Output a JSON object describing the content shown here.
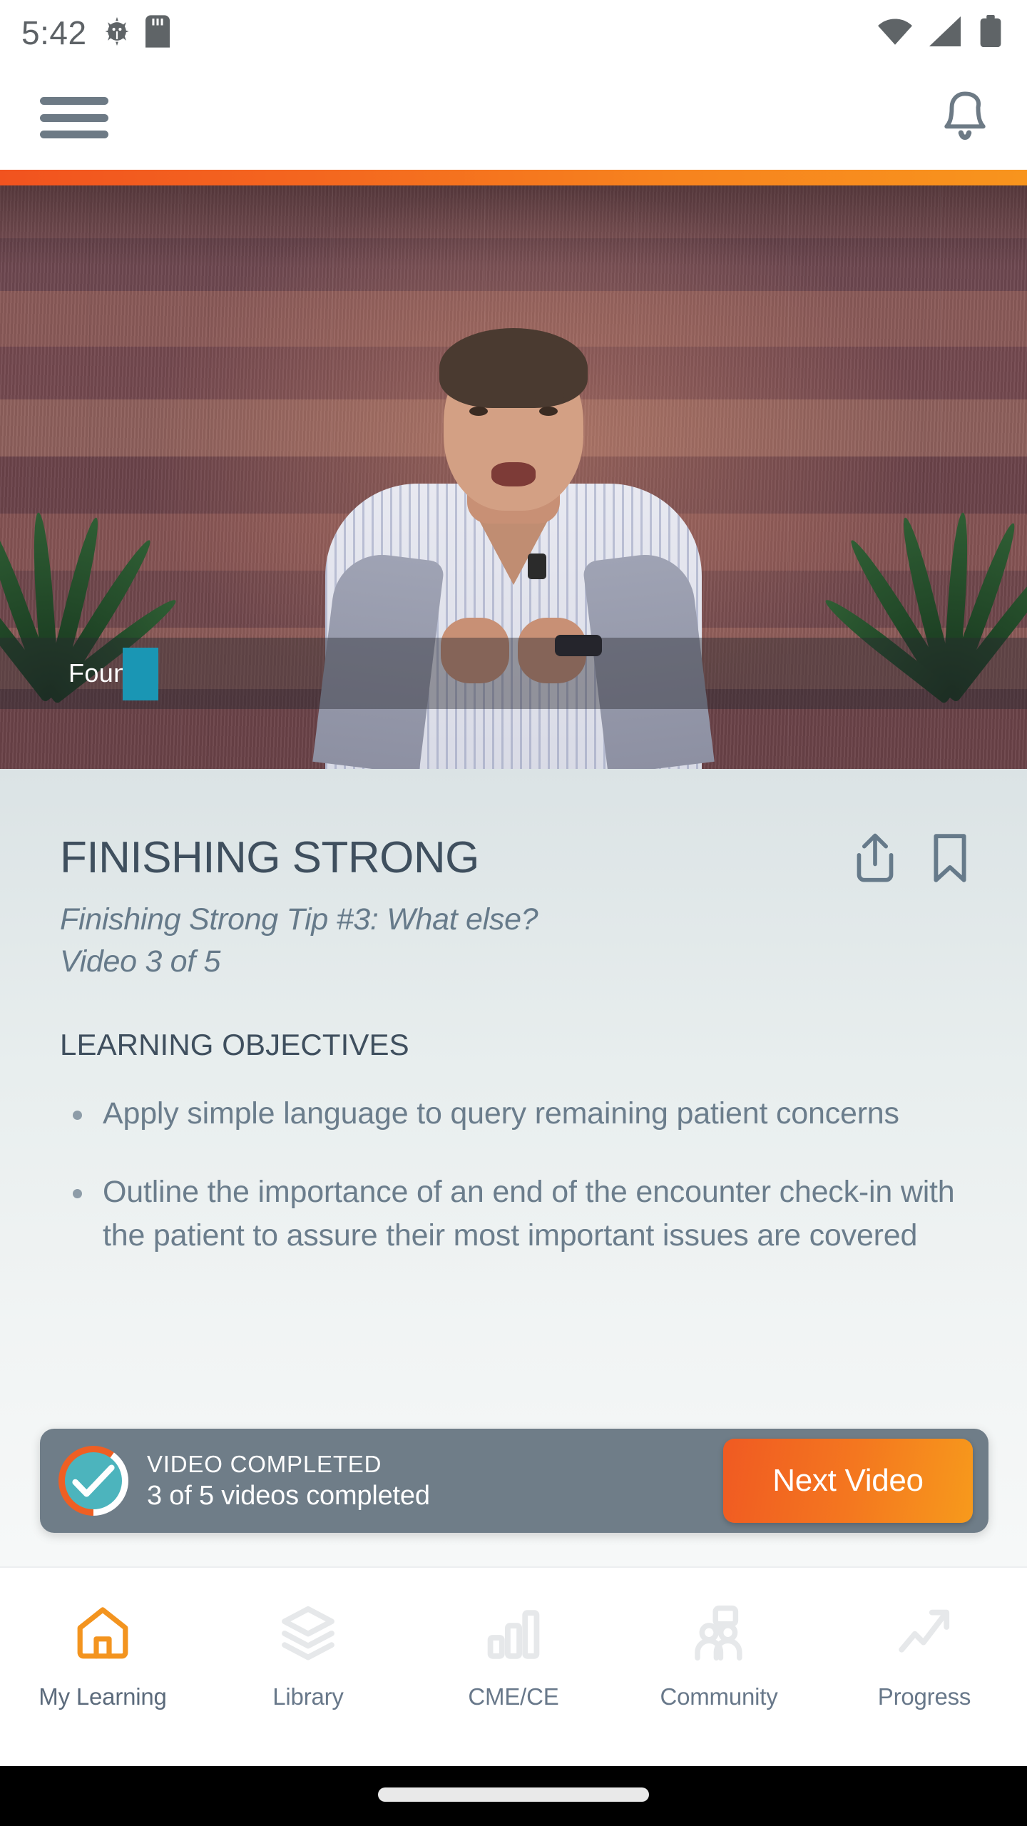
{
  "status_bar": {
    "time": "5:42",
    "left_icons": [
      "android-bug-icon",
      "sd-card-icon"
    ],
    "right_icons": [
      "wifi-icon",
      "cellular-signal-icon",
      "battery-icon"
    ]
  },
  "app_bar": {
    "menu_icon": "hamburger-menu-icon",
    "notification_icon": "bell-icon",
    "accent_bar_colors": [
      "#f1531f",
      "#f8941d"
    ]
  },
  "video": {
    "caption_overlay": "Foun",
    "overlay_block_color": "#1a96b4"
  },
  "detail": {
    "title": "FINISHING STRONG",
    "subtitle_line1": "Finishing Strong Tip #3: What else?",
    "subtitle_line2": "Video 3 of 5",
    "share_icon": "share-icon",
    "bookmark_icon": "bookmark-icon",
    "objectives_heading": "LEARNING OBJECTIVES",
    "objectives": [
      "Apply simple language to query remaining patient concerns",
      "Outline the importance of an end of the encounter check-in with the patient to assure their most important issues are covered"
    ]
  },
  "completion_banner": {
    "status_label": "VIDEO COMPLETED",
    "progress_text": "3 of 5 videos completed",
    "next_button_label": "Next Video",
    "check_icon": "check-circle-icon",
    "completed": 3,
    "total": 5,
    "ring_color": "#ef5f23",
    "circle_color": "#4cb4bd",
    "banner_color": "#6f7d88",
    "button_color": "#f4771f"
  },
  "bottom_nav": {
    "active_color": "#f3941f",
    "items": [
      {
        "label": "My Learning",
        "icon": "home-icon",
        "active": true
      },
      {
        "label": "Library",
        "icon": "layers-icon",
        "active": false
      },
      {
        "label": "CME/CE",
        "icon": "bar-chart-icon",
        "active": false
      },
      {
        "label": "Community",
        "icon": "people-group-icon",
        "active": false
      },
      {
        "label": "Progress",
        "icon": "trending-up-icon",
        "active": false
      }
    ]
  }
}
